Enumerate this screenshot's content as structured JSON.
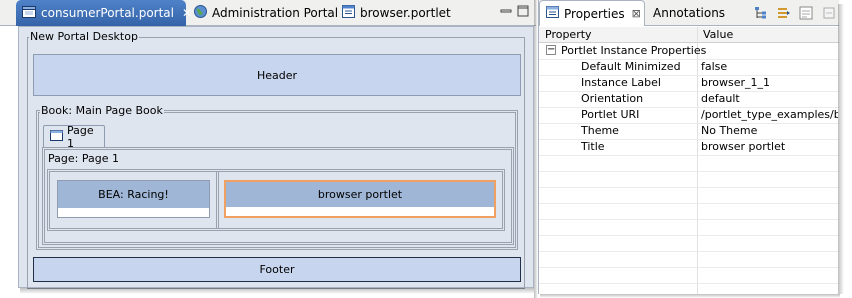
{
  "editor": {
    "tabs": [
      {
        "label": "consumerPortal.portal",
        "icon": "portal-file-icon",
        "active": true
      },
      {
        "label": "Administration Portal",
        "icon": "globe-icon",
        "active": false
      },
      {
        "label": "browser.portlet",
        "icon": "portlet-file-icon",
        "active": false
      }
    ],
    "close_glyph": "✕",
    "desktop": {
      "title": "New Portal Desktop",
      "header": "Header",
      "book_title": "Book: Main Page Book",
      "page_tab": "Page 1",
      "page_title": "Page: Page 1",
      "portlets": [
        "BEA: Racing!",
        "browser portlet"
      ],
      "footer": "Footer"
    }
  },
  "properties": {
    "tabs": [
      {
        "label": "Properties",
        "icon": "properties-icon",
        "active": true
      },
      {
        "label": "Annotations",
        "active": false
      }
    ],
    "toolbar_icons": [
      "tree-view-icon",
      "show-categories-icon",
      "advanced-properties-icon",
      "restore-default-icon"
    ],
    "columns": [
      "Property",
      "Value"
    ],
    "group": {
      "toggle": "−",
      "label": "Portlet Instance Properties"
    },
    "rows": [
      {
        "property": "Default Minimized",
        "value": "false"
      },
      {
        "property": "Instance Label",
        "value": "browser_1_1"
      },
      {
        "property": "Orientation",
        "value": "default"
      },
      {
        "property": "Portlet URI",
        "value": "/portlet_type_examples/bro"
      },
      {
        "property": "Theme",
        "value": "No Theme"
      },
      {
        "property": "Title",
        "value": "browser portlet"
      }
    ]
  },
  "colors": {
    "tab_active": "#3d6eb5",
    "panel_blue": "#c7d6ee",
    "editor_bg": "#dfe5ef",
    "portlet_header": "#9fb6d6",
    "selected_border": "#f0a060"
  }
}
